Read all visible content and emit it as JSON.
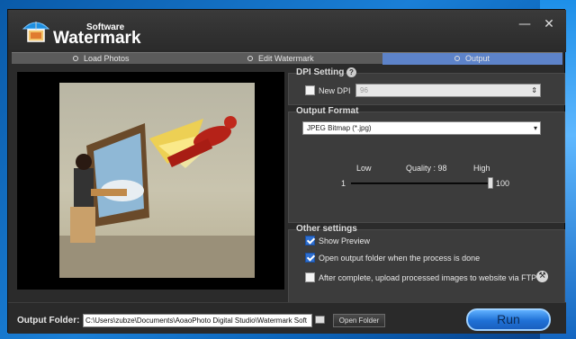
{
  "app": {
    "brand_small": "Software",
    "brand_main": "Watermark",
    "minimize": "—",
    "close": "✕"
  },
  "steps": [
    {
      "label": "Load Photos",
      "active": false
    },
    {
      "label": "Edit Watermark",
      "active": false
    },
    {
      "label": "Output",
      "active": true
    }
  ],
  "dpi": {
    "title": "DPI Setting",
    "help": "?",
    "checkbox_label": "New DPI",
    "checked": false,
    "value": "96"
  },
  "output_format": {
    "title": "Output Format",
    "selected": "JPEG Bitmap (*.jpg)"
  },
  "quality": {
    "low_label": "Low",
    "high_label": "High",
    "caption": "Quality : 98",
    "min": "1",
    "max": "100",
    "value": 98
  },
  "other": {
    "title": "Other settings",
    "options": [
      {
        "label": "Show Preview",
        "checked": true
      },
      {
        "label": "Open output folder when the process is done",
        "checked": true
      },
      {
        "label": "After complete, upload processed images to website via FTP",
        "checked": false
      }
    ]
  },
  "bottom": {
    "folder_label": "Output Folder:",
    "folder_path": "C:\\Users\\zubze\\Documents\\AoaoPhoto Digital Studio\\Watermark Soft",
    "open_folder": "Open Folder",
    "run": "Run"
  }
}
